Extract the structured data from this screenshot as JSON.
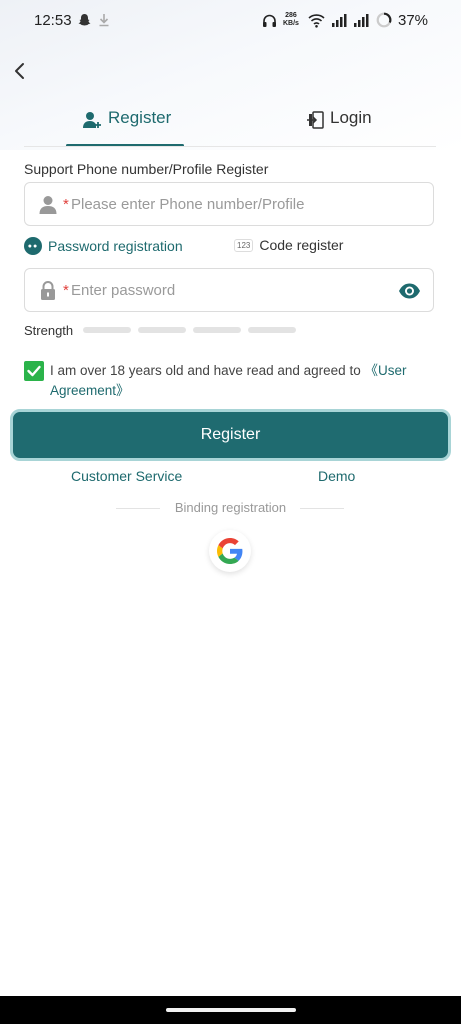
{
  "status_bar": {
    "time": "12:53",
    "net_speed_value": "286",
    "net_speed_unit": "KB/s",
    "battery": "37%"
  },
  "tabs": {
    "register": "Register",
    "login": "Login"
  },
  "form": {
    "section_label": "Support Phone number/Profile Register",
    "required_mark": "*",
    "phone_placeholder": "Please enter Phone number/Profile",
    "password_placeholder": "Enter password",
    "mode_password": "Password registration",
    "mode_code": "Code register",
    "mode_code_badge": "123",
    "strength_label": "Strength",
    "strength_level": 0
  },
  "agreement": {
    "text": "I am over 18 years old and have read and agreed to ",
    "link": "《User Agreement》",
    "checked": true
  },
  "actions": {
    "register_button": "Register",
    "customer_service": "Customer Service",
    "demo": "Demo",
    "binding_label": "Binding registration"
  },
  "icons": {
    "back": "chevron-left-icon",
    "register_tab": "add-user-icon",
    "login_tab": "door-login-icon",
    "phone_field": "user-icon",
    "password_field": "lock-icon",
    "visibility": "eye-icon",
    "social": "google-icon"
  },
  "colors": {
    "brand": "#1e6a6e",
    "required": "#e0403c",
    "checkbox": "#2bb34a"
  }
}
